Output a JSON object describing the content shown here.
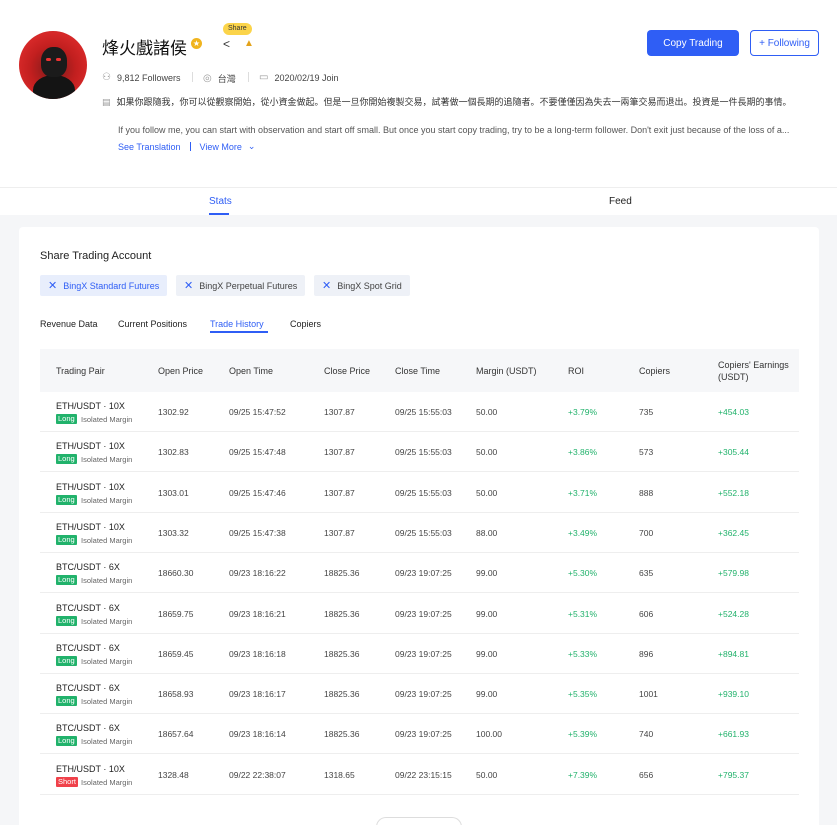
{
  "profile": {
    "name": "烽火戲諸侯",
    "share_label": "Share",
    "followers": "9,812 Followers",
    "location": "台灣",
    "join": "2020/02/19 Join",
    "bio_zh": "如果你跟隨我，你可以從觀察開始，從小資金做起。但是一旦你開始複製交易，試著做一個長期的追隨者。不要僅僅因為失去一兩筆交易而退出。投資是一件長期的事情。",
    "bio_en": "If you follow me, you can start with observation and start off small. But once you start copy trading, try to be a long-term follower. Don't exit just because of the loss of a...",
    "see_translation": "See Translation",
    "view_more": "View More"
  },
  "actions": {
    "copy_trading": "Copy Trading",
    "following": "Following"
  },
  "main_tabs": {
    "stats": "Stats",
    "feed": "Feed"
  },
  "card": {
    "title": "Share Trading Account",
    "accounts": [
      "BingX Standard Futures",
      "BingX Perpetual Futures",
      "BingX Spot Grid"
    ],
    "sub_tabs": [
      "Revenue Data",
      "Current Positions",
      "Trade History",
      "Copiers"
    ]
  },
  "table": {
    "headers": [
      "Trading Pair",
      "Open Price",
      "Open Time",
      "Close Price",
      "Close Time",
      "Margin (USDT)",
      "ROI",
      "Copiers",
      "Copiers' Earnings",
      "(USDT)"
    ],
    "margin_type": "Isolated Margin",
    "rows": [
      {
        "pair": "ETH/USDT · 10X",
        "side": "Long",
        "open_price": "1302.92",
        "open_time": "09/25 15:47:52",
        "close_price": "1307.87",
        "close_time": "09/25 15:55:03",
        "margin": "50.00",
        "roi": "+3.79%",
        "copiers": "735",
        "earnings": "+454.03"
      },
      {
        "pair": "ETH/USDT · 10X",
        "side": "Long",
        "open_price": "1302.83",
        "open_time": "09/25 15:47:48",
        "close_price": "1307.87",
        "close_time": "09/25 15:55:03",
        "margin": "50.00",
        "roi": "+3.86%",
        "copiers": "573",
        "earnings": "+305.44"
      },
      {
        "pair": "ETH/USDT · 10X",
        "side": "Long",
        "open_price": "1303.01",
        "open_time": "09/25 15:47:46",
        "close_price": "1307.87",
        "close_time": "09/25 15:55:03",
        "margin": "50.00",
        "roi": "+3.71%",
        "copiers": "888",
        "earnings": "+552.18"
      },
      {
        "pair": "ETH/USDT · 10X",
        "side": "Long",
        "open_price": "1303.32",
        "open_time": "09/25 15:47:38",
        "close_price": "1307.87",
        "close_time": "09/25 15:55:03",
        "margin": "88.00",
        "roi": "+3.49%",
        "copiers": "700",
        "earnings": "+362.45"
      },
      {
        "pair": "BTC/USDT · 6X",
        "side": "Long",
        "open_price": "18660.30",
        "open_time": "09/23 18:16:22",
        "close_price": "18825.36",
        "close_time": "09/23 19:07:25",
        "margin": "99.00",
        "roi": "+5.30%",
        "copiers": "635",
        "earnings": "+579.98"
      },
      {
        "pair": "BTC/USDT · 6X",
        "side": "Long",
        "open_price": "18659.75",
        "open_time": "09/23 18:16:21",
        "close_price": "18825.36",
        "close_time": "09/23 19:07:25",
        "margin": "99.00",
        "roi": "+5.31%",
        "copiers": "606",
        "earnings": "+524.28"
      },
      {
        "pair": "BTC/USDT · 6X",
        "side": "Long",
        "open_price": "18659.45",
        "open_time": "09/23 18:16:18",
        "close_price": "18825.36",
        "close_time": "09/23 19:07:25",
        "margin": "99.00",
        "roi": "+5.33%",
        "copiers": "896",
        "earnings": "+894.81"
      },
      {
        "pair": "BTC/USDT · 6X",
        "side": "Long",
        "open_price": "18658.93",
        "open_time": "09/23 18:16:17",
        "close_price": "18825.36",
        "close_time": "09/23 19:07:25",
        "margin": "99.00",
        "roi": "+5.35%",
        "copiers": "1001",
        "earnings": "+939.10"
      },
      {
        "pair": "BTC/USDT · 6X",
        "side": "Long",
        "open_price": "18657.64",
        "open_time": "09/23 18:16:14",
        "close_price": "18825.36",
        "close_time": "09/23 19:07:25",
        "margin": "100.00",
        "roi": "+5.39%",
        "copiers": "740",
        "earnings": "+661.93"
      },
      {
        "pair": "ETH/USDT · 10X",
        "side": "Short",
        "open_price": "1328.48",
        "open_time": "09/22 22:38:07",
        "close_price": "1318.65",
        "close_time": "09/22 23:15:15",
        "margin": "50.00",
        "roi": "+7.39%",
        "copiers": "656",
        "earnings": "+795.37"
      }
    ]
  },
  "colors": {
    "accent": "#2f5ef5",
    "positive": "#21b26b",
    "negative": "#f0414a"
  }
}
